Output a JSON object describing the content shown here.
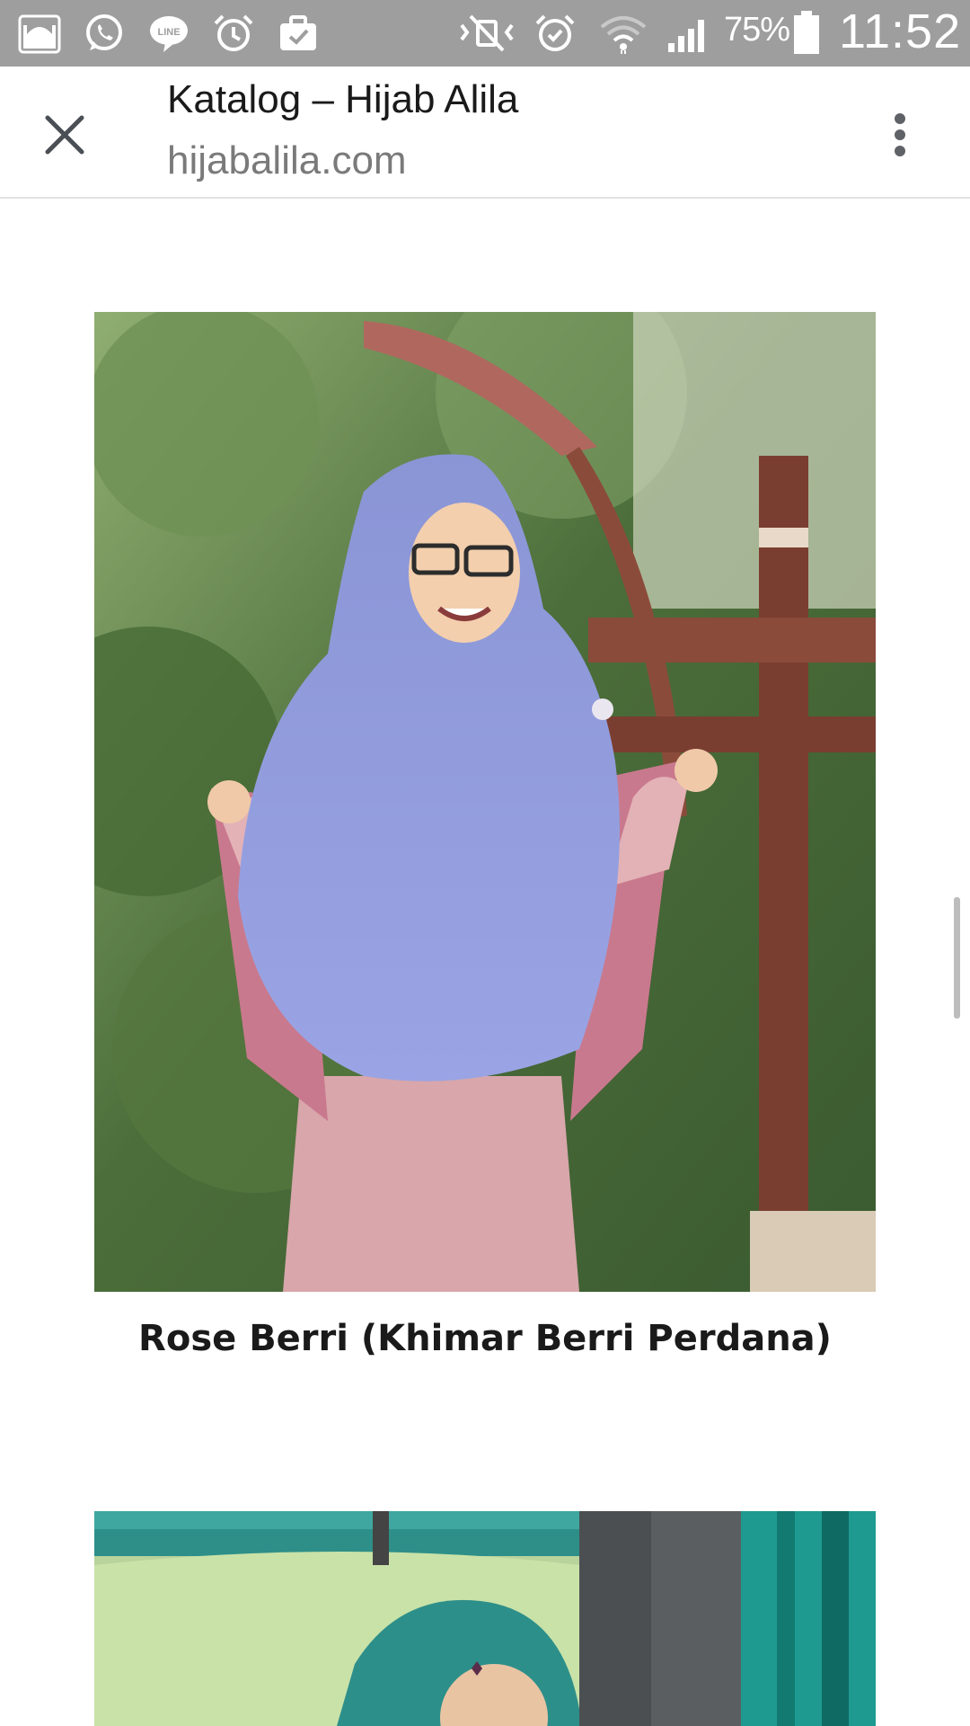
{
  "status_bar": {
    "battery_percent": "75%",
    "time": "11:52",
    "background_color": "#9e9e9e",
    "left_icons": [
      "mosque-app-icon",
      "whatsapp-icon",
      "line-icon",
      "alarm-icon",
      "briefcase-check-icon"
    ],
    "right_icons": [
      "mute-icon",
      "alarm-icon",
      "wifi-icon",
      "signal-icon",
      "battery-icon"
    ]
  },
  "toolbar": {
    "title": "Katalog – Hijab Alila",
    "url": "hijabalila.com",
    "close_icon": "close-icon",
    "menu_icon": "more-vert-icon"
  },
  "products": [
    {
      "name": "Rose Berri (Khimar Berri Perdana)",
      "image": "product-photo"
    },
    {
      "name": "",
      "image": "product-photo"
    }
  ]
}
